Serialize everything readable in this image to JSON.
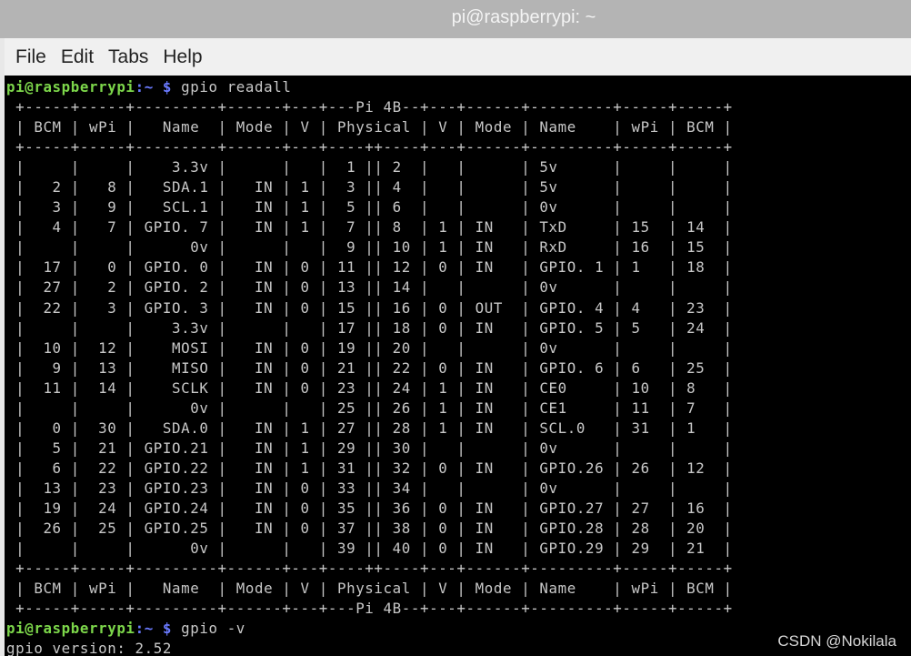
{
  "window": {
    "title": "pi@raspberrypi: ~"
  },
  "menu": [
    "File",
    "Edit",
    "Tabs",
    "Help"
  ],
  "terminal": {
    "prompt_user": "pi@raspberrypi",
    "prompt_sep": ":",
    "prompt_path": "~ $",
    "cmd1": " gpio readall",
    "table_lines": [
      " +-----+-----+---------+------+---+---Pi 4B--+---+------+---------+-----+-----+",
      " | BCM | wPi |   Name  | Mode | V | Physical | V | Mode | Name    | wPi | BCM |",
      " +-----+-----+---------+------+---+----++----+---+------+---------+-----+-----+",
      " |     |     |    3.3v |      |   |  1 || 2  |   |      | 5v      |     |     |",
      " |   2 |   8 |   SDA.1 |   IN | 1 |  3 || 4  |   |      | 5v      |     |     |",
      " |   3 |   9 |   SCL.1 |   IN | 1 |  5 || 6  |   |      | 0v      |     |     |",
      " |   4 |   7 | GPIO. 7 |   IN | 1 |  7 || 8  | 1 | IN   | TxD     | 15  | 14  |",
      " |     |     |      0v |      |   |  9 || 10 | 1 | IN   | RxD     | 16  | 15  |",
      " |  17 |   0 | GPIO. 0 |   IN | 0 | 11 || 12 | 0 | IN   | GPIO. 1 | 1   | 18  |",
      " |  27 |   2 | GPIO. 2 |   IN | 0 | 13 || 14 |   |      | 0v      |     |     |",
      " |  22 |   3 | GPIO. 3 |   IN | 0 | 15 || 16 | 0 | OUT  | GPIO. 4 | 4   | 23  |",
      " |     |     |    3.3v |      |   | 17 || 18 | 0 | IN   | GPIO. 5 | 5   | 24  |",
      " |  10 |  12 |    MOSI |   IN | 0 | 19 || 20 |   |      | 0v      |     |     |",
      " |   9 |  13 |    MISO |   IN | 0 | 21 || 22 | 0 | IN   | GPIO. 6 | 6   | 25  |",
      " |  11 |  14 |    SCLK |   IN | 0 | 23 || 24 | 1 | IN   | CE0     | 10  | 8   |",
      " |     |     |      0v |      |   | 25 || 26 | 1 | IN   | CE1     | 11  | 7   |",
      " |   0 |  30 |   SDA.0 |   IN | 1 | 27 || 28 | 1 | IN   | SCL.0   | 31  | 1   |",
      " |   5 |  21 | GPIO.21 |   IN | 1 | 29 || 30 |   |      | 0v      |     |     |",
      " |   6 |  22 | GPIO.22 |   IN | 1 | 31 || 32 | 0 | IN   | GPIO.26 | 26  | 12  |",
      " |  13 |  23 | GPIO.23 |   IN | 0 | 33 || 34 |   |      | 0v      |     |     |",
      " |  19 |  24 | GPIO.24 |   IN | 0 | 35 || 36 | 0 | IN   | GPIO.27 | 27  | 16  |",
      " |  26 |  25 | GPIO.25 |   IN | 0 | 37 || 38 | 0 | IN   | GPIO.28 | 28  | 20  |",
      " |     |     |      0v |      |   | 39 || 40 | 0 | IN   | GPIO.29 | 29  | 21  |",
      " +-----+-----+---------+------+---+----++----+---+------+---------+-----+-----+",
      " | BCM | wPi |   Name  | Mode | V | Physical | V | Mode | Name    | wPi | BCM |",
      " +-----+-----+---------+------+---+---Pi 4B--+---+------+---------+-----+-----+"
    ],
    "cmd2": " gpio -v",
    "version_line": "gpio version: 2.52"
  },
  "watermark": "CSDN @Nokilala"
}
